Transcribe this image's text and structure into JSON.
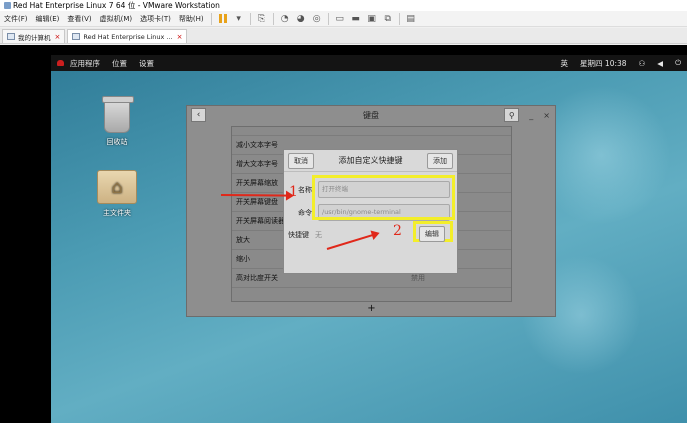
{
  "window": {
    "title": "Red Hat Enterprise Linux 7 64 位 - VMware Workstation"
  },
  "menu": {
    "items": [
      "文件(F)",
      "编辑(E)",
      "查看(V)",
      "虚拟机(M)",
      "选项卡(T)",
      "帮助(H)"
    ]
  },
  "tabs": [
    {
      "label": "我的计算机",
      "close": "×"
    },
    {
      "label": "Red Hat Enterprise Linux ...",
      "close": "×"
    }
  ],
  "gnome": {
    "apps": "应用程序",
    "places": "位置",
    "settings": "设置",
    "input_method": "英",
    "clock": "星期四 10:38"
  },
  "desktop": {
    "trash_label": "回收站",
    "home_label": "主文件夹"
  },
  "keyboard_window": {
    "title": "键盘",
    "back_glyph": "‹",
    "search_glyph": "⚲",
    "minimize_glyph": "_",
    "close_glyph": "×",
    "rows": [
      {
        "name": "减小文本字号",
        "value": ""
      },
      {
        "name": "增大文本字号",
        "value": ""
      },
      {
        "name": "开关屏幕缩放",
        "value": ""
      },
      {
        "name": "开关屏幕键盘",
        "value": ""
      },
      {
        "name": "开关屏幕阅读器",
        "value": ""
      },
      {
        "name": "放大",
        "value": ""
      },
      {
        "name": "缩小",
        "value": ""
      },
      {
        "name": "高对比度开关",
        "value": "禁用"
      }
    ],
    "add_glyph": "+"
  },
  "dialog": {
    "title": "添加自定义快捷键",
    "cancel": "取消",
    "add": "添加",
    "name_label": "名称",
    "name_placeholder": "打开终端",
    "command_label": "命令",
    "command_placeholder": "/usr/bin/gnome-terminal",
    "shortcut_label": "快捷键",
    "shortcut_value": "无",
    "edit": "编辑"
  },
  "annotations": {
    "step1": "1",
    "step2": "2"
  },
  "colors": {
    "highlight": "#f3ee2a",
    "annotation": "#e0281a"
  }
}
